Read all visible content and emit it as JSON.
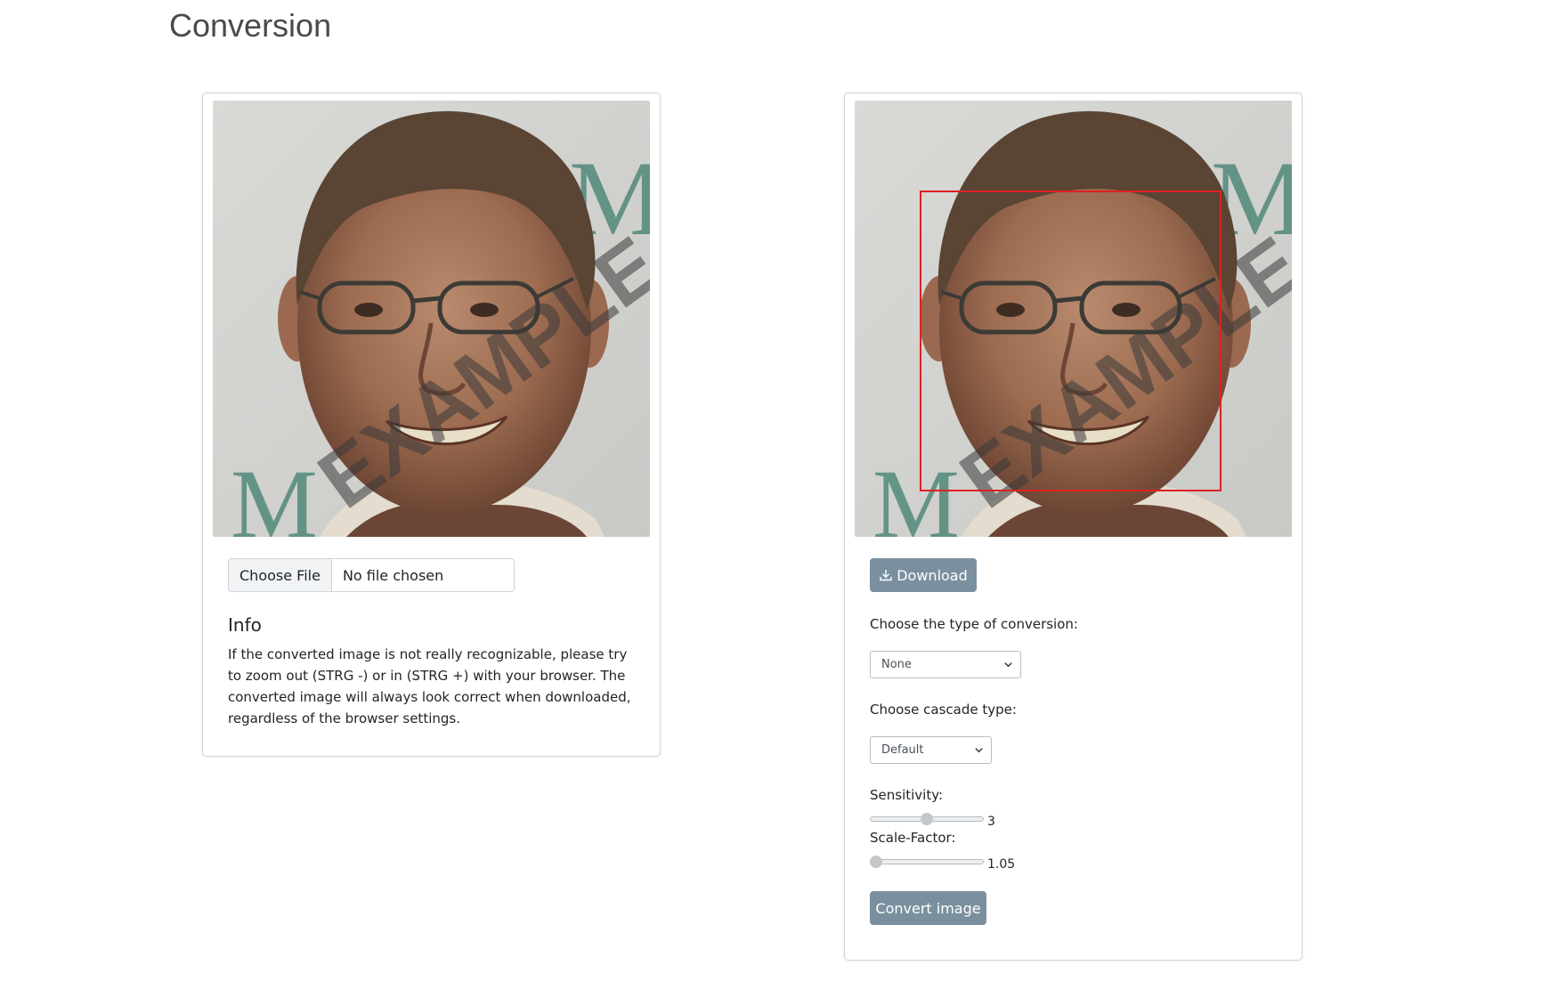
{
  "page": {
    "title": "Conversion"
  },
  "left_panel": {
    "image_watermark": "EXAMPLE",
    "file_input": {
      "button_label": "Choose File",
      "status": "No file chosen"
    },
    "info": {
      "title": "Info",
      "text": "If the converted image is not really recognizable, please try to zoom out (STRG -) or in (STRG +) with your browser. The converted image will always look correct when downloaded, regardless of the browser settings."
    }
  },
  "right_panel": {
    "image_watermark": "EXAMPLE",
    "face_detection": {
      "detected": true,
      "box_color": "#e02020"
    },
    "download_button": {
      "label": "Download",
      "icon": "download-icon"
    },
    "conversion_type": {
      "label": "Choose the type of conversion:",
      "selected": "None"
    },
    "cascade_type": {
      "label": "Choose cascade type:",
      "selected": "Default"
    },
    "sensitivity": {
      "label": "Sensitivity:",
      "value": "3",
      "position_fraction": 0.5
    },
    "scale_factor": {
      "label": "Scale-Factor:",
      "value": "1.05",
      "position_fraction": 0.0
    },
    "convert_button": {
      "label": "Convert image"
    }
  },
  "colors": {
    "button_bg": "#7a909e",
    "button_text": "#ffffff",
    "card_border": "#d5d5d5",
    "title_text": "#4a4a4a"
  }
}
